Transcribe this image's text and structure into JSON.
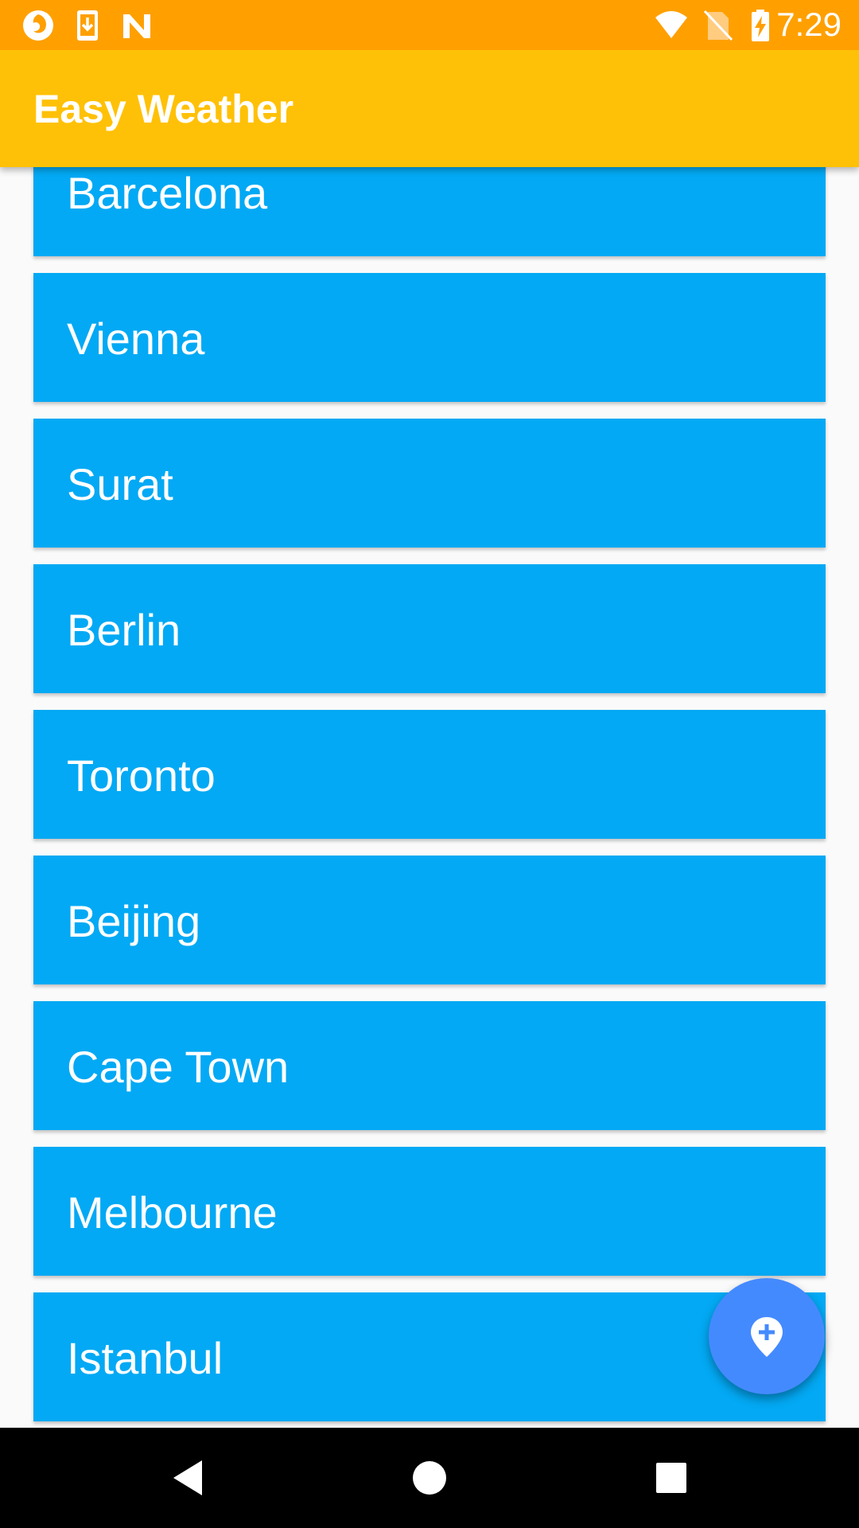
{
  "status_bar": {
    "time": "7:29",
    "left_icons": [
      "firefox-icon",
      "download-icon",
      "n-logo-icon"
    ],
    "right_icons": [
      "wifi-icon",
      "no-sim-icon",
      "battery-charging-icon"
    ],
    "background_color": "#ffa000"
  },
  "app_bar": {
    "title": "Easy Weather",
    "background_color": "#ffc107"
  },
  "cities": [
    {
      "name": "Barcelona"
    },
    {
      "name": "Vienna"
    },
    {
      "name": "Surat"
    },
    {
      "name": "Berlin"
    },
    {
      "name": "Toronto"
    },
    {
      "name": "Beijing"
    },
    {
      "name": "Cape Town"
    },
    {
      "name": "Melbourne"
    },
    {
      "name": "Istanbul"
    }
  ],
  "list": {
    "card_color": "#03a9f4"
  },
  "fab": {
    "icon": "add-location-icon",
    "color": "#448aff"
  },
  "nav_bar": {
    "buttons": [
      "back-icon",
      "home-icon",
      "recents-icon"
    ]
  }
}
